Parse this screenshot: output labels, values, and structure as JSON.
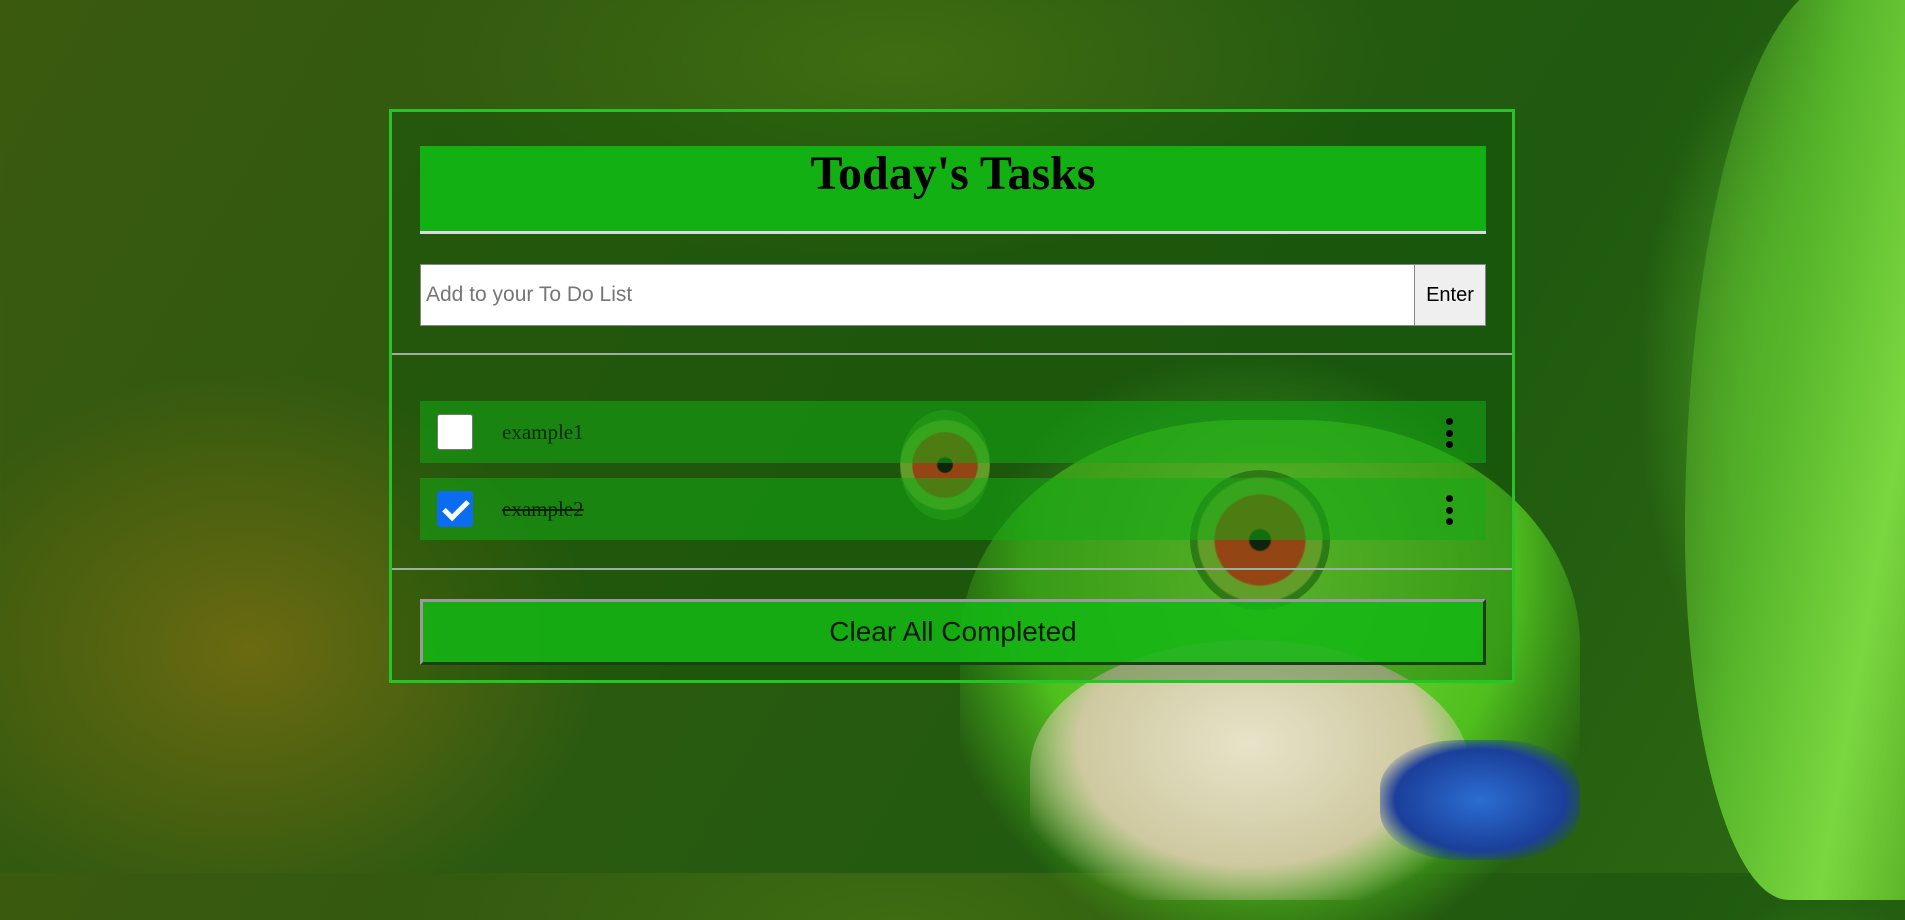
{
  "header": {
    "title": "Today's Tasks"
  },
  "add_task": {
    "placeholder": "Add to your To Do List",
    "value": "",
    "submit_label": "Enter"
  },
  "tasks": [
    {
      "label": "example1",
      "completed": false,
      "menu_icon": "more-vertical-icon"
    },
    {
      "label": "example2",
      "completed": true,
      "menu_icon": "more-vertical-icon"
    }
  ],
  "actions": {
    "clear_completed_label": "Clear All Completed"
  },
  "colors": {
    "accent_green": "#12b012",
    "border_green": "#27c427",
    "checkbox_checked": "#0b6cf0"
  }
}
